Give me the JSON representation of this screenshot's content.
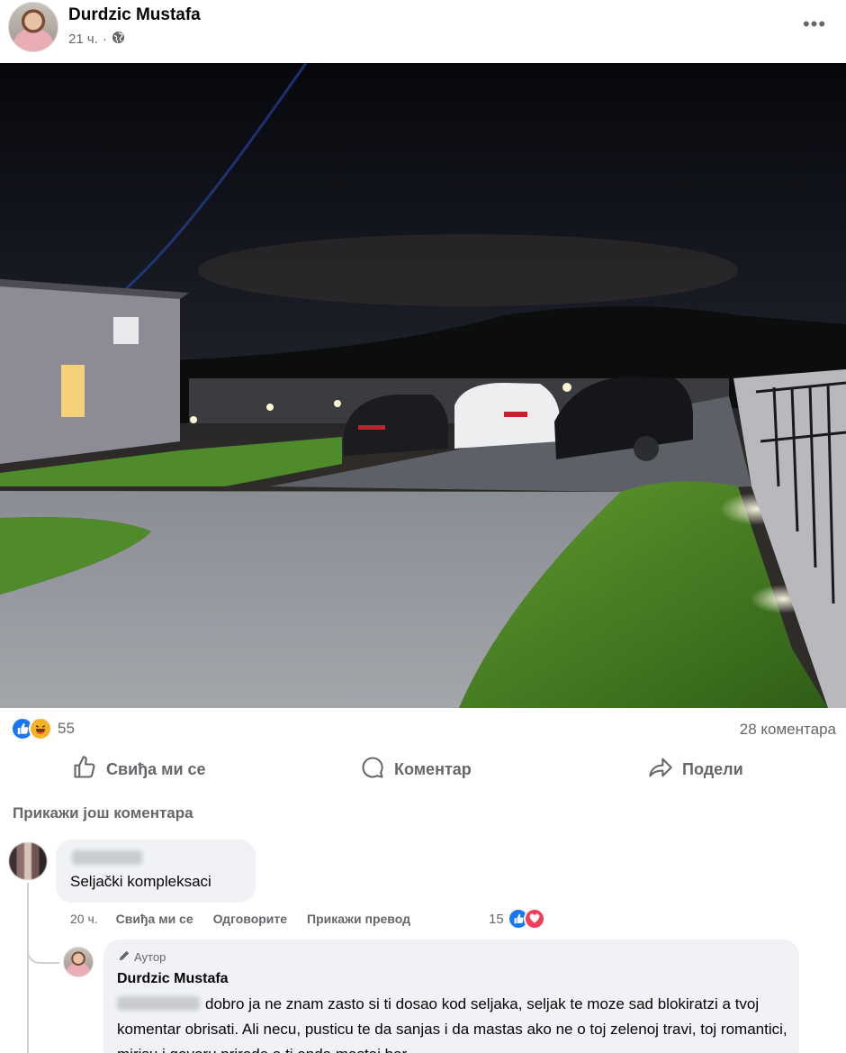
{
  "post": {
    "author": "Durdzic Mustafa",
    "time": "21 ч.",
    "separator": "·",
    "privacy_icon": "globe-icon",
    "more_icon": "more-icon",
    "more_glyph": "•••"
  },
  "reactions": {
    "count": "55",
    "icons": [
      "like-icon",
      "haha-icon"
    ],
    "comments_label": "28 коментара"
  },
  "actions": {
    "like_label": "Свиђа ми се",
    "comment_label": "Коментар",
    "share_label": "Подели"
  },
  "more_comments_label": "Прикажи још коментара",
  "comments": [
    {
      "text": "Seljački kompleksaci",
      "time": "20 ч.",
      "like_label": "Свиђа ми се",
      "reply_label": "Одговорите",
      "translate_label": "Прикажи превод",
      "reaction_count": "15"
    }
  ],
  "reply": {
    "badge": "Аутор",
    "author": "Durdzic Mustafa",
    "text": "dobro ja ne znam zasto si ti dosao kod seljaka, seljak te moze sad blokiratzi a tvoj komentar obrisati. Ali necu, pusticu te da sanjas i da mastas ako ne o toj zelenoj travi, toj romantici, mirisu i govoru prirode a ti onda mastaj bar"
  },
  "colors": {
    "secondary_text": "#65676b",
    "bubble": "#f0f2f5",
    "like_blue": "#1877f2",
    "love_red": "#f33e58",
    "haha_yellow": "#f7b125"
  }
}
